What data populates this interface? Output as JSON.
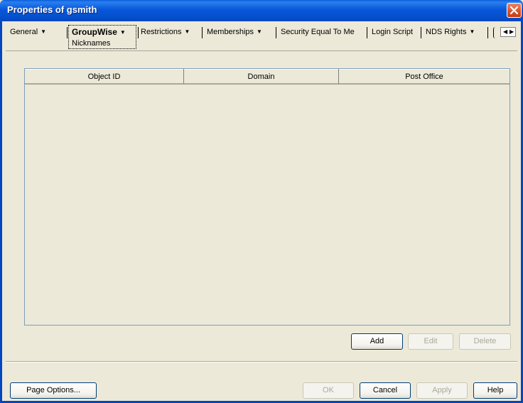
{
  "window": {
    "title": "Properties of gsmith"
  },
  "tabs": [
    {
      "label": "General",
      "has_menu": true
    },
    {
      "label": "GroupWise",
      "has_menu": true,
      "active": true,
      "subpage": "Nicknames"
    },
    {
      "label": "Restrictions",
      "has_menu": true
    },
    {
      "label": "Memberships",
      "has_menu": true
    },
    {
      "label": "Security Equal To Me",
      "has_menu": false
    },
    {
      "label": "Login Script",
      "has_menu": false
    },
    {
      "label": "NDS Rights",
      "has_menu": true
    }
  ],
  "table": {
    "columns": [
      "Object ID",
      "Domain",
      "Post Office"
    ],
    "rows": []
  },
  "table_buttons": {
    "add": "Add",
    "edit": "Edit",
    "delete": "Delete"
  },
  "footer": {
    "page_options": "Page Options...",
    "ok": "OK",
    "cancel": "Cancel",
    "apply": "Apply",
    "help": "Help"
  },
  "icons": {
    "close": "close-icon",
    "tab_arrow": "chevron-down-icon",
    "scroll_left": "scroll-left-icon",
    "scroll_right": "scroll-right-icon"
  },
  "colors": {
    "titlebar": "#0857d8",
    "close": "#d8512a",
    "dialog_bg": "#ece9d8",
    "disabled_text": "#aca899"
  }
}
